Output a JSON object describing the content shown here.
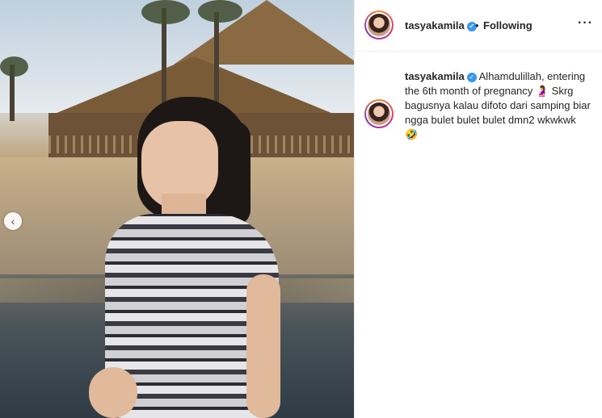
{
  "post": {
    "prev_arrow": "‹",
    "photo_alt": ""
  },
  "header": {
    "username": "tasyakamila",
    "verified_icon": "✓",
    "dot": "•",
    "follow_status": "Following",
    "more_icon": "···"
  },
  "caption": {
    "username": "tasyakamila",
    "verified_icon": "✓",
    "text": "Alhamdulillah, entering the 6th month of pregnancy 🤰 Skrg bagusnya kalau difoto dari samping biar ngga bulet bulet bulet dmn2 wkwkwk 🤣"
  },
  "colors": {
    "verified": "#3897f0",
    "text": "#262626",
    "divider": "#efefef"
  }
}
